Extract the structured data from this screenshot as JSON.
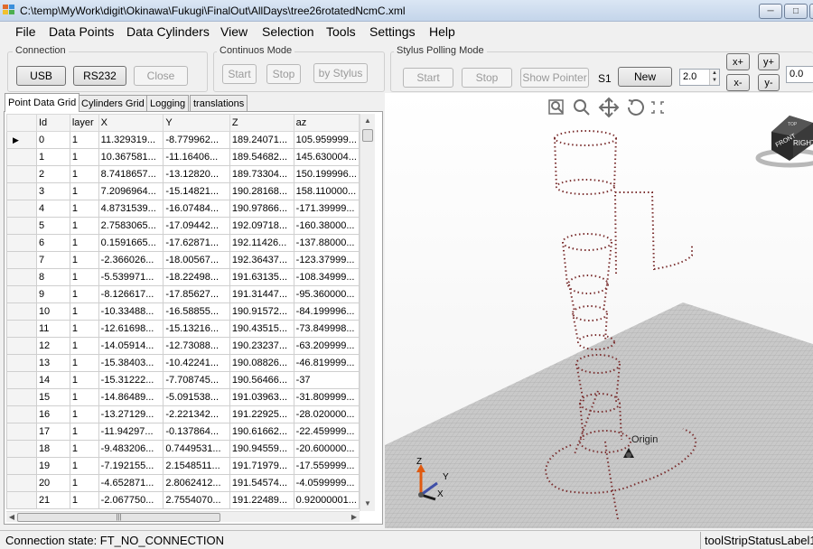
{
  "window": {
    "title": "C:\\temp\\MyWork\\digit\\Okinawa\\Fukugi\\FinalOut\\AllDays\\tree26rotatedNcmC.xml"
  },
  "menu": [
    "File",
    "Data Points",
    "Data Cylinders",
    "View",
    "Selection",
    "Tools",
    "Settings",
    "Help"
  ],
  "connection": {
    "legend": "Connection",
    "usb": "USB",
    "rs232": "RS232",
    "close": "Close"
  },
  "continuous": {
    "legend": "Continuos Mode",
    "start": "Start",
    "stop": "Stop",
    "by_stylus": "by Stylus"
  },
  "stylus": {
    "legend": "Stylus Polling Mode",
    "start": "Start",
    "stop": "Stop",
    "show_pointer": "Show Pointer",
    "s1_label": "S1",
    "new": "New",
    "value1": "2.0",
    "xplus": "x+",
    "xminus": "x-",
    "yplus": "y+",
    "yminus": "y-",
    "value2": "0.0"
  },
  "tabs": [
    "Point Data Grid",
    "Cylinders Grid",
    "Logging",
    "translations"
  ],
  "grid": {
    "columns": [
      "Id",
      "layer",
      "X",
      "Y",
      "Z",
      "az"
    ],
    "rows": [
      [
        "0",
        "1",
        "11.329319...",
        "-8.779962...",
        "189.24071...",
        "105.959999..."
      ],
      [
        "1",
        "1",
        "10.367581...",
        "-11.16406...",
        "189.54682...",
        "145.630004..."
      ],
      [
        "2",
        "1",
        "8.7418657...",
        "-13.12820...",
        "189.73304...",
        "150.199996..."
      ],
      [
        "3",
        "1",
        "7.2096964...",
        "-15.14821...",
        "190.28168...",
        "158.110000..."
      ],
      [
        "4",
        "1",
        "4.8731539...",
        "-16.07484...",
        "190.97866...",
        "-171.39999..."
      ],
      [
        "5",
        "1",
        "2.7583065...",
        "-17.09442...",
        "192.09718...",
        "-160.38000..."
      ],
      [
        "6",
        "1",
        "0.1591665...",
        "-17.62871...",
        "192.11426...",
        "-137.88000..."
      ],
      [
        "7",
        "1",
        "-2.366026...",
        "-18.00567...",
        "192.36437...",
        "-123.37999..."
      ],
      [
        "8",
        "1",
        "-5.539971...",
        "-18.22498...",
        "191.63135...",
        "-108.34999..."
      ],
      [
        "9",
        "1",
        "-8.126617...",
        "-17.85627...",
        "191.31447...",
        "-95.360000..."
      ],
      [
        "10",
        "1",
        "-10.33488...",
        "-16.58855...",
        "190.91572...",
        "-84.199996..."
      ],
      [
        "11",
        "1",
        "-12.61698...",
        "-15.13216...",
        "190.43515...",
        "-73.849998..."
      ],
      [
        "12",
        "1",
        "-14.05914...",
        "-12.73088...",
        "190.23237...",
        "-63.209999..."
      ],
      [
        "13",
        "1",
        "-15.38403...",
        "-10.42241...",
        "190.08826...",
        "-46.819999..."
      ],
      [
        "14",
        "1",
        "-15.31222...",
        "-7.708745...",
        "190.56466...",
        "-37"
      ],
      [
        "15",
        "1",
        "-14.86489...",
        "-5.091538...",
        "191.03963...",
        "-31.809999..."
      ],
      [
        "16",
        "1",
        "-13.27129...",
        "-2.221342...",
        "191.22925...",
        "-28.020000..."
      ],
      [
        "17",
        "1",
        "-11.94297...",
        "-0.137864...",
        "190.61662...",
        "-22.459999..."
      ],
      [
        "18",
        "1",
        "-9.483206...",
        "0.7449531...",
        "190.94559...",
        "-20.600000..."
      ],
      [
        "19",
        "1",
        "-7.192155...",
        "2.1548511...",
        "191.71979...",
        "-17.559999..."
      ],
      [
        "20",
        "1",
        "-4.652871...",
        "2.8062412...",
        "191.54574...",
        "-4.0599999..."
      ],
      [
        "21",
        "1",
        "-2.067750...",
        "2.7554070...",
        "191.22489...",
        "0.92000001..."
      ]
    ],
    "current_row": 0
  },
  "view": {
    "cube_face_front": "FRONT",
    "cube_face_right": "RIGHT",
    "cube_face_top": "TOP",
    "origin_label": "Origin",
    "axis_z": "Z",
    "axis_y": "Y",
    "axis_x": "X",
    "toolbar_icons": [
      "zoom-window-icon",
      "zoom-icon",
      "pan-icon",
      "rotate-icon",
      "fit-all-icon"
    ]
  },
  "status": {
    "connection": "Connection state: FT_NO_CONNECTION",
    "label": "toolStripStatusLabel1"
  },
  "colors": {
    "grid_floor": "#c7c7c7",
    "points": "#7a2e2e",
    "title_bar": "#c9d9ee"
  }
}
